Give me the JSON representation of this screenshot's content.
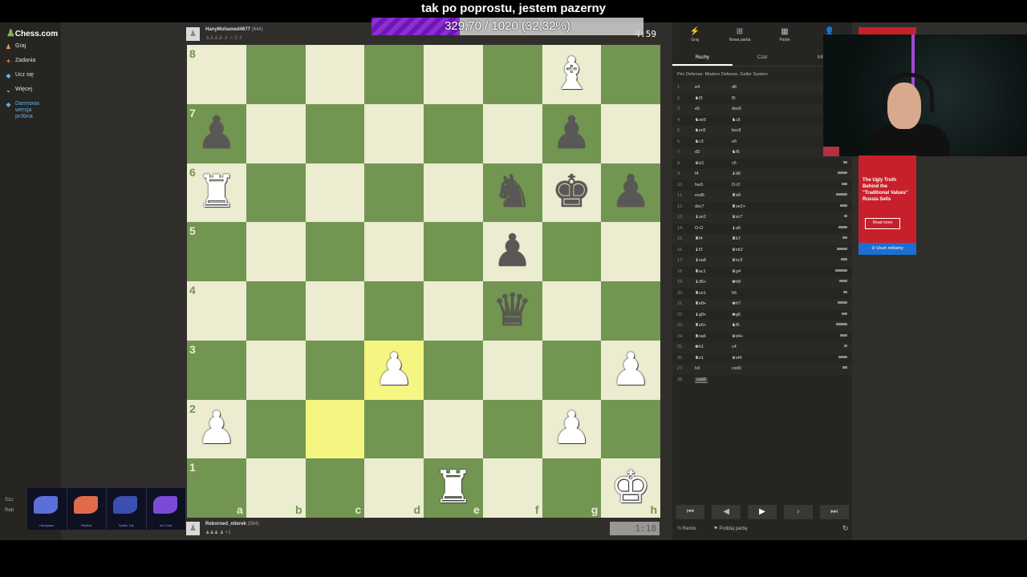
{
  "overlay": {
    "caption": "tak po poprostu, jestem pazerny",
    "donation_text": "329,70 / 1020 (32,32%)",
    "donation_progress": 0.3232
  },
  "sidebar": {
    "logo": "Chess.com",
    "items": [
      {
        "label": "Graj",
        "icon": "pawn-icon"
      },
      {
        "label": "Zadania",
        "icon": "puzzle-icon"
      },
      {
        "label": "Ucz się",
        "icon": "learn-icon"
      },
      {
        "label": "Więcej",
        "icon": "chevron-down-icon"
      },
      {
        "label": "Darmowa wersja próbna",
        "icon": "diamond-icon"
      }
    ],
    "bottom": [
      "Szu",
      "Reb"
    ],
    "stickers": [
      "Hampaaw",
      "Redline",
      "Spider Lily",
      "Ice Code"
    ]
  },
  "top_player": {
    "name": "HanyMohamed4677",
    "rating": "(644)",
    "clock": "4:59"
  },
  "bottom_player": {
    "name": "Reborned_niterek",
    "rating": "(594)",
    "clock": "1:18"
  },
  "board": {
    "ranks": [
      "8",
      "7",
      "6",
      "5",
      "4",
      "3",
      "2",
      "1"
    ],
    "files": [
      "a",
      "b",
      "c",
      "d",
      "e",
      "f",
      "g",
      "h"
    ],
    "position": [
      [
        "",
        "",
        "",
        "",
        "",
        "",
        "B",
        ""
      ],
      [
        "p",
        "",
        "",
        "",
        "",
        "",
        "p",
        ""
      ],
      [
        "R",
        "",
        "",
        "",
        "",
        "n",
        "k",
        "p"
      ],
      [
        "",
        "",
        "",
        "",
        "",
        "p",
        "",
        ""
      ],
      [
        "",
        "",
        "",
        "",
        "",
        "q",
        "",
        ""
      ],
      [
        "",
        "",
        "",
        "P",
        "",
        "",
        "",
        "P"
      ],
      [
        "P",
        "",
        "",
        "",
        "",
        "",
        "P",
        ""
      ],
      [
        "",
        "",
        "",
        "",
        "R",
        "",
        "",
        "K"
      ]
    ],
    "last_move": [
      "c2",
      "d3"
    ]
  },
  "panel": {
    "tabs": [
      {
        "label": "Graj",
        "icon": "lightning-icon"
      },
      {
        "label": "Nowa partia",
        "icon": "plus-board-icon"
      },
      {
        "label": "Partie",
        "icon": "grid-icon"
      },
      {
        "label": "",
        "icon": "friends-icon"
      }
    ],
    "subtabs": [
      "Ruchy",
      "Czat",
      "Infor"
    ],
    "opening": "Pirc Defense: Modern Defense, Geller System",
    "moves": [
      {
        "n": "1.",
        "w": "e4",
        "b": "d6"
      },
      {
        "n": "2.",
        "w": "♞f3",
        "b": "f5"
      },
      {
        "n": "3.",
        "w": "e5",
        "b": "dxe5"
      },
      {
        "n": "4.",
        "w": "♞xe5",
        "b": "♞c6"
      },
      {
        "n": "5.",
        "w": "♞xc6",
        "b": "bxc6"
      },
      {
        "n": "6.",
        "w": "♞c3",
        "b": "e5"
      },
      {
        "n": "7.",
        "w": "d3",
        "b": "♞f6"
      },
      {
        "n": "8.",
        "w": "♛e2",
        "b": "c5"
      },
      {
        "n": "9.",
        "w": "f4",
        "b": "♝d6"
      },
      {
        "n": "10.",
        "w": "fxe5",
        "b": "O-O"
      },
      {
        "n": "11.",
        "w": "exd6",
        "b": "♜e8"
      },
      {
        "n": "12.",
        "w": "dxc7",
        "b": "♜xe2+"
      },
      {
        "n": "13.",
        "w": "♝xe2",
        "b": "♛xc7"
      },
      {
        "n": "14.",
        "w": "O-O",
        "b": "♝a6"
      },
      {
        "n": "15.",
        "w": "♜f4",
        "b": "♜b7"
      },
      {
        "n": "16.",
        "w": "♝f3",
        "b": "♛xb2"
      },
      {
        "n": "17.",
        "w": "♝xa8",
        "b": "♛xc3"
      },
      {
        "n": "18.",
        "w": "♜ac1",
        "b": "♛g4"
      },
      {
        "n": "19.",
        "w": "♝d5+",
        "b": "♚h8"
      },
      {
        "n": "20.",
        "w": "♜ce1",
        "b": "h6"
      },
      {
        "n": "21.",
        "w": "♜e8+",
        "b": "♚h7"
      },
      {
        "n": "22.",
        "w": "♝g8+",
        "b": "♚g6"
      },
      {
        "n": "23.",
        "w": "♜e6+",
        "b": "♞f6"
      },
      {
        "n": "24.",
        "w": "♜xa6",
        "b": "♛d4+"
      },
      {
        "n": "25.",
        "w": "♚h1",
        "b": "c4"
      },
      {
        "n": "26.",
        "w": "♜e1",
        "b": "♛xf4"
      },
      {
        "n": "27.",
        "w": "h3",
        "b": "cxd3"
      },
      {
        "n": "28.",
        "w": "cxd3",
        "b": ""
      }
    ],
    "draw_label": "Remis",
    "resign_label": "Poddaj partię"
  },
  "ad": {
    "text": "The Ugly Truth Behind the \"Traditional Values\" Russia Sells",
    "button": "Read more",
    "remove": "Usuń reklamy"
  }
}
